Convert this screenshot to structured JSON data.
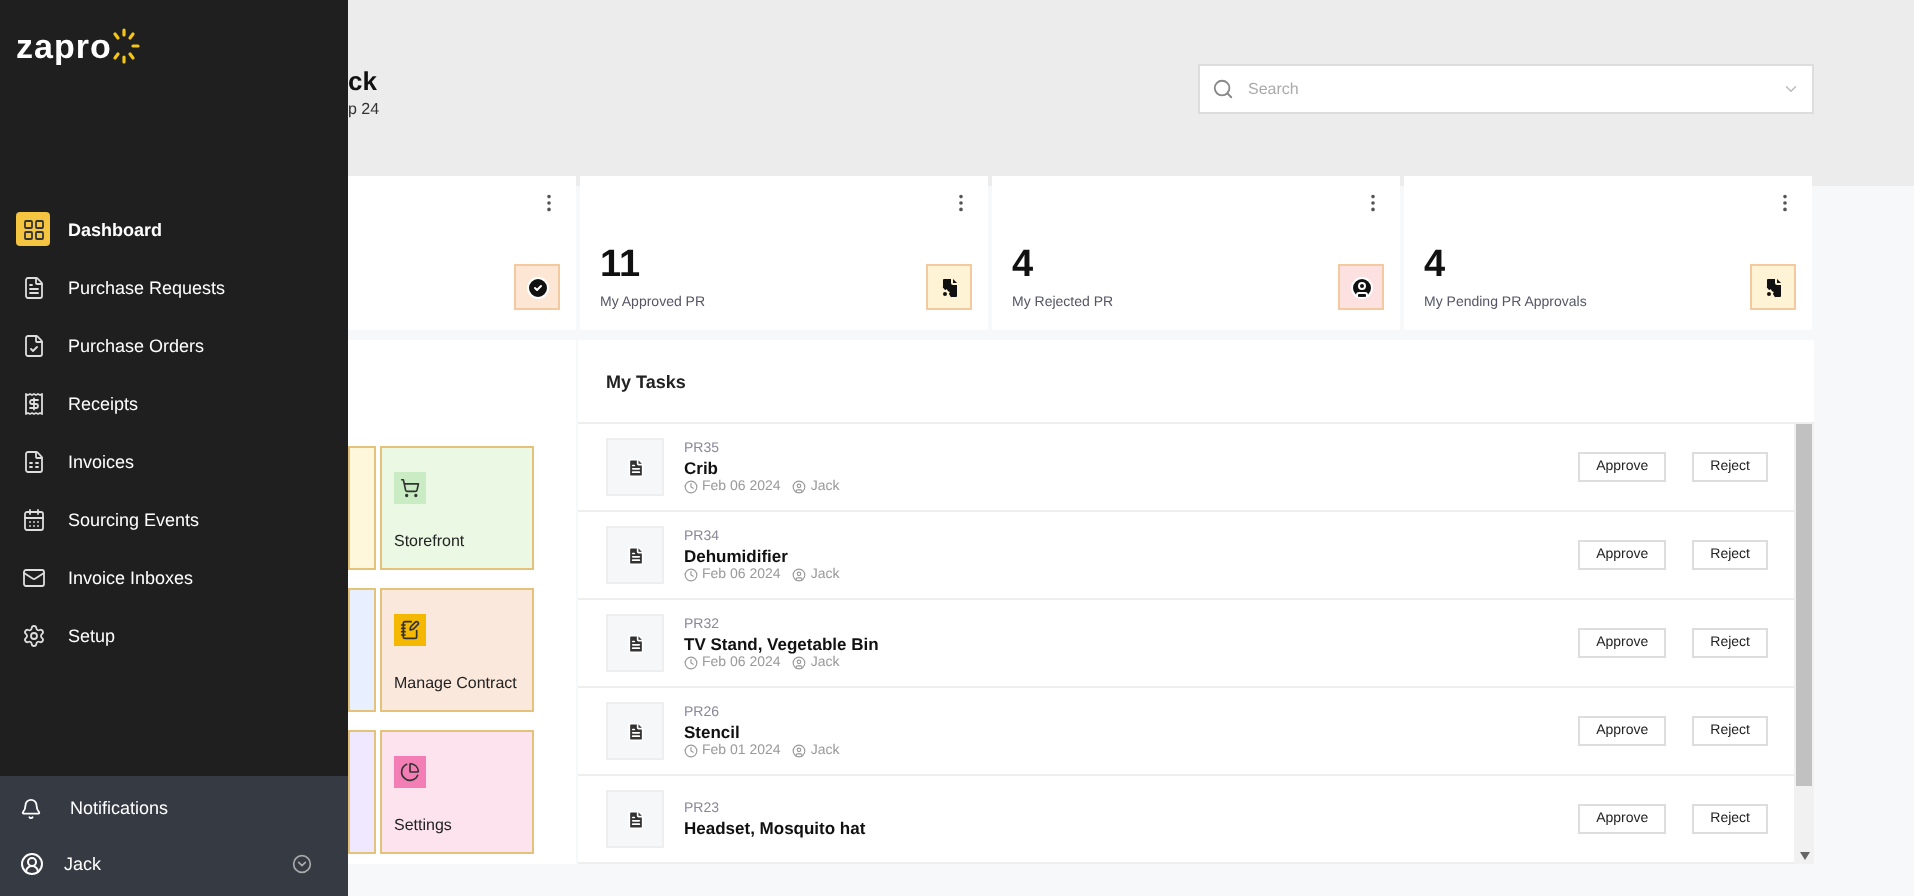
{
  "sidebar": {
    "logo": "zapro",
    "items": [
      {
        "label": "Dashboard",
        "selected": true
      },
      {
        "label": "Purchase Requests",
        "selected": false
      },
      {
        "label": "Purchase Orders",
        "selected": false
      },
      {
        "label": "Receipts",
        "selected": false
      },
      {
        "label": "Invoices",
        "selected": false
      },
      {
        "label": "Sourcing Events",
        "selected": false
      },
      {
        "label": "Invoice Inboxes",
        "selected": false
      },
      {
        "label": "Setup",
        "selected": false
      }
    ],
    "notifications": "Notifications",
    "user": "Jack"
  },
  "header": {
    "title": "ck",
    "subtitle": "p 24",
    "search": {
      "placeholder": "Search"
    }
  },
  "stats": [
    {
      "color": "#fde6d4"
    },
    {
      "value": "11",
      "label": "My Approved PR",
      "color": "#fff3d6"
    },
    {
      "value": "4",
      "label": "My Rejected PR",
      "color": "#fde0e0"
    },
    {
      "value": "4",
      "label": "My Pending PR Approvals",
      "color": "#fff3d6"
    }
  ],
  "quick_links": [
    {
      "color": "#fff7dc"
    },
    {
      "label": "Storefront",
      "color": "#eaf8e4"
    },
    {
      "color": "#e8efff"
    },
    {
      "label": "Manage Contract",
      "color": "#fbe8dc"
    },
    {
      "color": "#efe8ff"
    },
    {
      "label": "Settings",
      "color": "#fde3ee"
    }
  ],
  "tasks": {
    "title": "My Tasks",
    "rows": [
      {
        "id": "PR35",
        "name": "Crib",
        "date": "Feb 06 2024",
        "user": "Jack",
        "approve": "Approve",
        "reject": "Reject"
      },
      {
        "id": "PR34",
        "name": "Dehumidifier",
        "date": "Feb 06 2024",
        "user": "Jack",
        "approve": "Approve",
        "reject": "Reject"
      },
      {
        "id": "PR32",
        "name": "TV Stand, Vegetable Bin",
        "date": "Feb 06 2024",
        "user": "Jack",
        "approve": "Approve",
        "reject": "Reject"
      },
      {
        "id": "PR26",
        "name": "Stencil",
        "date": "Feb 01 2024",
        "user": "Jack",
        "approve": "Approve",
        "reject": "Reject"
      },
      {
        "id": "PR23",
        "name": "Headset, Mosquito hat",
        "approve": "Approve",
        "reject": "Reject"
      }
    ]
  }
}
